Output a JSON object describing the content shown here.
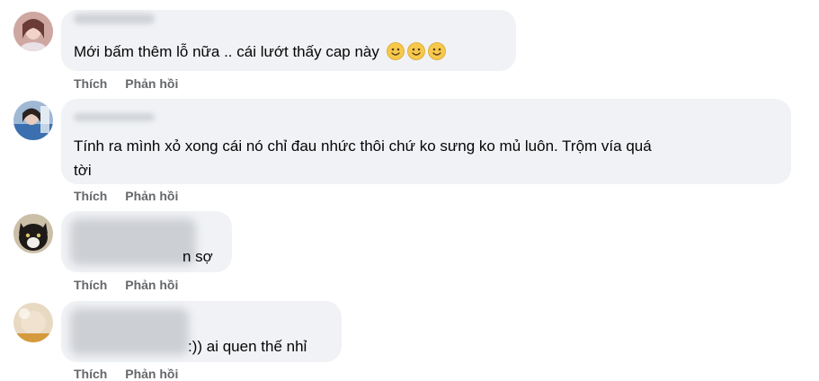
{
  "comments": [
    {
      "text": "Mới bấm thêm lỗ nữa .. cái lướt thấy cap này",
      "emojis": [
        "slightly-smiling-face",
        "slightly-smiling-face",
        "slightly-smiling-face"
      ],
      "like_label": "Thích",
      "reply_label": "Phản hồi"
    },
    {
      "text_line1": "Tính ra mình xỏ xong cái nó chỉ đau nhức thôi chứ ko sưng ko mủ luôn. Trộm vía quá",
      "text_line2": "tời",
      "like_label": "Thích",
      "reply_label": "Phản hồi"
    },
    {
      "text": "n sợ",
      "like_label": "Thích",
      "reply_label": "Phản hồi"
    },
    {
      "text": ":)) ai quen thế nhỉ",
      "like_label": "Thích",
      "reply_label": "Phản hồi"
    }
  ],
  "colors": {
    "bubble": "#f0f2f5",
    "action_text": "#65676b",
    "body_text": "#050505"
  }
}
